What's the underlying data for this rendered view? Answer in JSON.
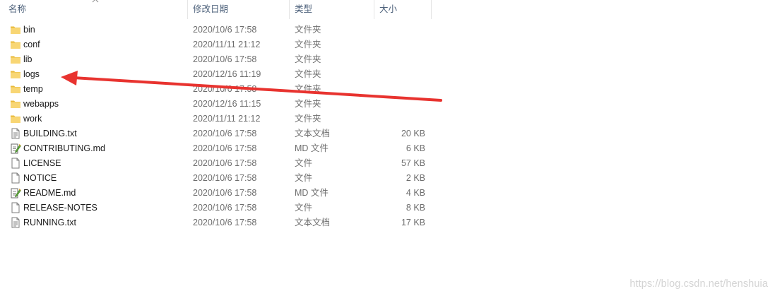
{
  "columns": {
    "name": "名称",
    "modified": "修改日期",
    "type": "类型",
    "size": "大小"
  },
  "files": [
    {
      "name": "bin",
      "modified": "2020/10/6 17:58",
      "type": "文件夹",
      "size": "",
      "icon": "folder-icon"
    },
    {
      "name": "conf",
      "modified": "2020/11/11 21:12",
      "type": "文件夹",
      "size": "",
      "icon": "folder-icon"
    },
    {
      "name": "lib",
      "modified": "2020/10/6 17:58",
      "type": "文件夹",
      "size": "",
      "icon": "folder-icon"
    },
    {
      "name": "logs",
      "modified": "2020/12/16 11:19",
      "type": "文件夹",
      "size": "",
      "icon": "folder-icon"
    },
    {
      "name": "temp",
      "modified": "2020/10/6 17:58",
      "type": "文件夹",
      "size": "",
      "icon": "folder-icon"
    },
    {
      "name": "webapps",
      "modified": "2020/12/16 11:15",
      "type": "文件夹",
      "size": "",
      "icon": "folder-icon"
    },
    {
      "name": "work",
      "modified": "2020/11/11 21:12",
      "type": "文件夹",
      "size": "",
      "icon": "folder-icon"
    },
    {
      "name": "BUILDING.txt",
      "modified": "2020/10/6 17:58",
      "type": "文本文档",
      "size": "20 KB",
      "icon": "text-document-icon"
    },
    {
      "name": "CONTRIBUTING.md",
      "modified": "2020/10/6 17:58",
      "type": "MD 文件",
      "size": "6 KB",
      "icon": "markdown-file-icon"
    },
    {
      "name": "LICENSE",
      "modified": "2020/10/6 17:58",
      "type": "文件",
      "size": "57 KB",
      "icon": "blank-file-icon"
    },
    {
      "name": "NOTICE",
      "modified": "2020/10/6 17:58",
      "type": "文件",
      "size": "2 KB",
      "icon": "blank-file-icon"
    },
    {
      "name": "README.md",
      "modified": "2020/10/6 17:58",
      "type": "MD 文件",
      "size": "4 KB",
      "icon": "markdown-file-icon"
    },
    {
      "name": "RELEASE-NOTES",
      "modified": "2020/10/6 17:58",
      "type": "文件",
      "size": "8 KB",
      "icon": "blank-file-icon"
    },
    {
      "name": "RUNNING.txt",
      "modified": "2020/10/6 17:58",
      "type": "文本文档",
      "size": "17 KB",
      "icon": "text-document-icon"
    }
  ],
  "watermark": "https://blog.csdn.net/henshuia",
  "colors": {
    "annotation_arrow": "#e8332f",
    "folder": "#f5c84c",
    "header_text": "#4c607a"
  }
}
